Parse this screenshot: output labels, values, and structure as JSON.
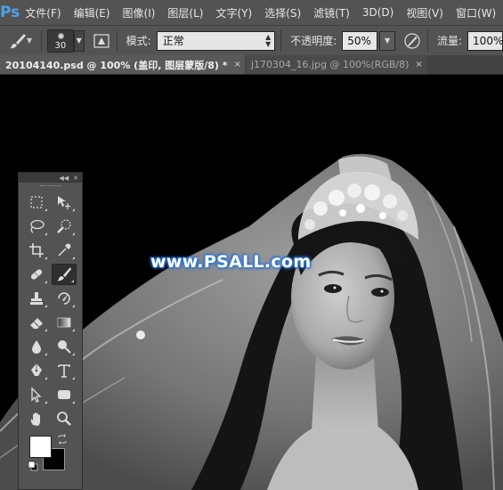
{
  "app": {
    "logo": "Ps"
  },
  "menu": [
    "文件(F)",
    "编辑(E)",
    "图像(I)",
    "图层(L)",
    "文字(Y)",
    "选择(S)",
    "滤镜(T)",
    "3D(D)",
    "视图(V)",
    "窗口(W)"
  ],
  "options": {
    "brush_size": "30",
    "mode_label": "模式:",
    "mode_value": "正常",
    "opacity_label": "不透明度:",
    "opacity_value": "50%",
    "flow_label": "流量:",
    "flow_value": "100%"
  },
  "tabs": [
    {
      "label": "20104140.psd @ 100% (盖印, 图层蒙版/8) *",
      "close": "×",
      "active": true
    },
    {
      "label": "j170304_16.jpg @ 100%(RGB/8)",
      "close": "×",
      "active": false
    }
  ],
  "canvas": {
    "watermark": "www.PSALL.com"
  },
  "toolbox": {
    "header_icons": [
      "collapse-icon",
      "close-icon"
    ],
    "rows": [
      [
        "rect-marquee-icon",
        "move-icon"
      ],
      [
        "lasso-icon",
        "quick-select-icon"
      ],
      [
        "crop-icon",
        "eyedropper-icon"
      ],
      [
        "healing-brush-icon",
        "brush-icon"
      ],
      [
        "clone-stamp-icon",
        "history-brush-icon"
      ],
      [
        "eraser-icon",
        "gradient-icon"
      ],
      [
        "blur-icon",
        "dodge-icon"
      ],
      [
        "pen-icon",
        "type-icon"
      ],
      [
        "path-select-icon",
        "shape-icon"
      ],
      [
        "hand-icon",
        "zoom-icon"
      ]
    ],
    "selected_tool": "brush-icon",
    "foreground_color": "#ffffff",
    "background_color": "#000000"
  }
}
